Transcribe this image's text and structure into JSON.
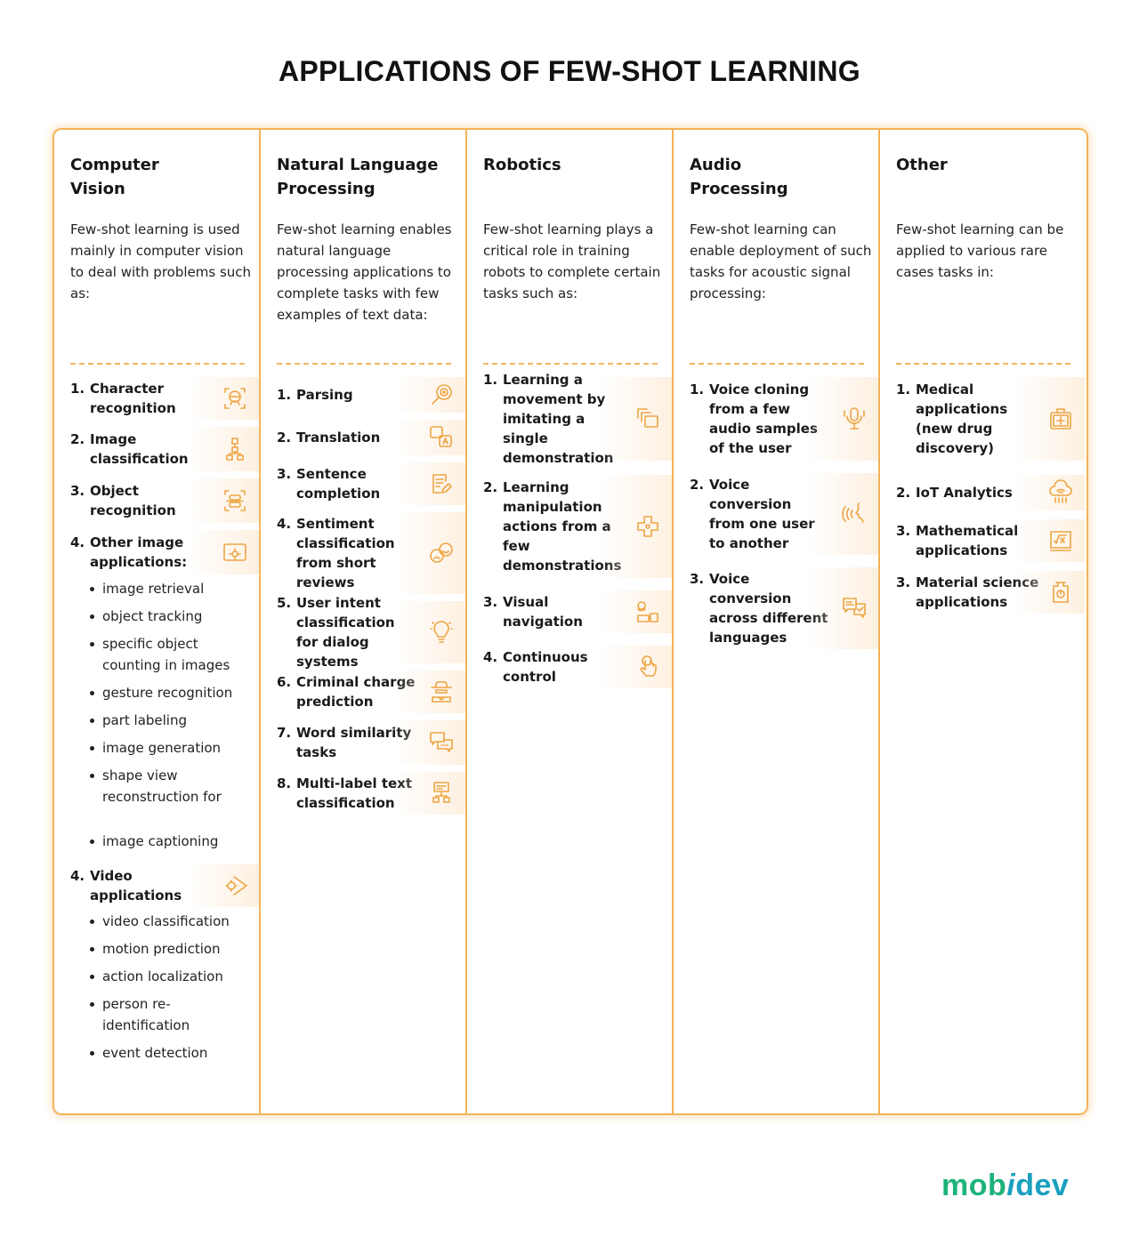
{
  "title": "APPLICATIONS OF FEW-SHOT LEARNING",
  "colors": {
    "accent": "#f2b35a",
    "icon": "#eda544",
    "logo_green": "#1db37a",
    "logo_blue": "#1a9fbf"
  },
  "columns": [
    {
      "heading": "Computer Vision",
      "description": "Few-shot learning is used mainly in computer vision to deal with problems such as:",
      "items": [
        {
          "num": "1.",
          "label": "Character recognition",
          "icon": "face-scan-icon"
        },
        {
          "num": "2.",
          "label": "Image classification",
          "icon": "hierarchy-icon"
        },
        {
          "num": "3.",
          "label": "Object recognition",
          "icon": "object-scan-icon"
        },
        {
          "num": "4.",
          "label": "Other image applications:",
          "icon": "image-gear-icon",
          "bullets": [
            "image retrieval",
            "object tracking",
            "specific object counting in images",
            "gesture recognition",
            "part labeling",
            "image generation",
            "shape view reconstruction for",
            "image captioning"
          ]
        },
        {
          "num": "4.",
          "label": "Video applications",
          "icon": "video-gear-icon",
          "bullets": [
            "video classification",
            "motion prediction",
            "action localization",
            "person re-identification",
            "event detection"
          ]
        }
      ]
    },
    {
      "heading": "Natural Language Processing",
      "description": "Few-shot learning enables natural language processing applications to complete tasks with few examples of text data:",
      "items": [
        {
          "num": "1.",
          "label": "Parsing",
          "icon": "magnifier-target-icon"
        },
        {
          "num": "2.",
          "label": "Translation",
          "icon": "translate-icon"
        },
        {
          "num": "3.",
          "label": "Sentence completion",
          "icon": "document-edit-icon"
        },
        {
          "num": "4.",
          "label": "Sentiment classification from short reviews",
          "icon": "emotion-faces-icon"
        },
        {
          "num": "5.",
          "label": "User intent classification for dialog systems",
          "icon": "lightbulb-icon"
        },
        {
          "num": "6.",
          "label": "Criminal charge prediction",
          "icon": "detective-icon"
        },
        {
          "num": "7.",
          "label": "Word similarity tasks",
          "icon": "chat-bubbles-icon"
        },
        {
          "num": "8.",
          "label": "Multi-label text classification",
          "icon": "text-hierarchy-icon"
        }
      ]
    },
    {
      "heading": "Robotics",
      "description": "Few-shot learning plays a critical role in training robots to complete certain tasks such as:",
      "items": [
        {
          "num": "1.",
          "label": "Learning a movement by imitating a single demonstration",
          "icon": "copy-layers-icon"
        },
        {
          "num": "2.",
          "label": "Learning manipulation actions from a few demonstrations",
          "icon": "gamepad-cross-icon"
        },
        {
          "num": "3.",
          "label": "Visual navigation",
          "icon": "route-pin-icon"
        },
        {
          "num": "4.",
          "label": "Continuous control",
          "icon": "touch-hand-icon"
        }
      ]
    },
    {
      "heading": "Audio Processing",
      "description": "Few-shot learning can enable deployment of such tasks for acoustic signal processing:",
      "items": [
        {
          "num": "1.",
          "label": "Voice cloning from a few audio samples of the user",
          "icon": "microphone-icon"
        },
        {
          "num": "2.",
          "label": "Voice conversion from one user to another",
          "icon": "voice-speaking-icon"
        },
        {
          "num": "3.",
          "label": "Voice conversion across different languages",
          "icon": "language-chat-icon"
        }
      ]
    },
    {
      "heading": "Other",
      "description": "Few-shot learning can be applied to various rare cases tasks in:",
      "items": [
        {
          "num": "1.",
          "label": "Medical applications (new drug discovery)",
          "icon": "medical-kit-icon"
        },
        {
          "num": "2.",
          "label": "IoT Analytics",
          "icon": "cloud-iot-icon"
        },
        {
          "num": "3.",
          "label": "Mathematical applications",
          "icon": "square-root-icon"
        },
        {
          "num": "3.",
          "label": "Material science applications",
          "icon": "flask-icon"
        }
      ]
    }
  ],
  "logo": {
    "part1": "mob",
    "part2": "i",
    "part3": "dev"
  }
}
